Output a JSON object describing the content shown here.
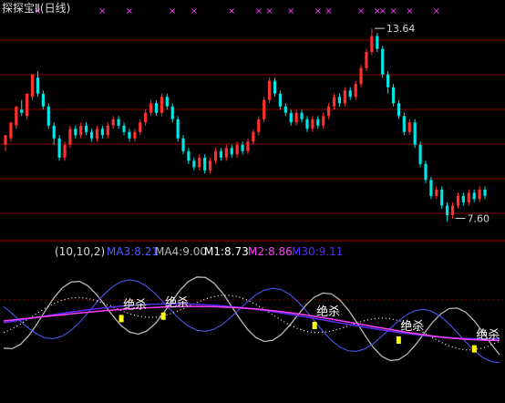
{
  "colors": {
    "background": "#000000",
    "grid": "#8b0000",
    "up_candle": "#ff3030",
    "down_candle": "#00e5e5",
    "marker": "#ff40ff",
    "signal": "#ffff00",
    "ma3": "#4f5cff",
    "ma4": "#b8b8b8",
    "m1": "#ffffff",
    "m2": "#ff40ff",
    "m30": "#5a2bff"
  },
  "chart_data": [
    {
      "type": "candlestick",
      "title": "探探宝Ⅱ(日线)",
      "annotations": [
        {
          "text": "13.64",
          "kind": "high"
        },
        {
          "text": "7.60",
          "kind": "low"
        }
      ],
      "candles": [
        [
          10.0,
          10.3,
          9.8,
          10.25
        ],
        [
          10.2,
          10.7,
          10.1,
          10.6
        ],
        [
          10.6,
          11.2,
          10.5,
          11.1
        ],
        [
          11.1,
          11.0,
          11.4,
          10.9
        ],
        [
          10.9,
          11.6,
          10.8,
          11.5
        ],
        [
          11.5,
          12.2,
          11.4,
          12.1
        ],
        [
          12.1,
          11.6,
          12.3,
          11.5
        ],
        [
          11.6,
          11.2,
          11.7,
          11.1
        ],
        [
          11.2,
          10.6,
          11.3,
          10.5
        ],
        [
          10.6,
          10.2,
          10.7,
          10.0
        ],
        [
          10.2,
          9.6,
          10.3,
          9.5
        ],
        [
          9.6,
          10.0,
          9.5,
          10.1
        ],
        [
          10.0,
          10.5,
          9.9,
          10.6
        ],
        [
          10.5,
          10.3,
          10.6,
          10.2
        ],
        [
          10.3,
          10.6,
          10.2,
          10.7
        ],
        [
          10.6,
          10.4,
          10.7,
          10.3
        ],
        [
          10.4,
          10.2,
          10.5,
          10.1
        ],
        [
          10.2,
          10.5,
          10.1,
          10.6
        ],
        [
          10.5,
          10.3,
          10.6,
          10.2
        ],
        [
          10.3,
          10.6,
          10.2,
          10.7
        ],
        [
          10.6,
          10.8,
          10.5,
          10.9
        ],
        [
          10.8,
          10.6,
          10.9,
          10.5
        ],
        [
          10.6,
          10.4,
          10.7,
          10.3
        ],
        [
          10.4,
          10.2,
          10.5,
          10.1
        ],
        [
          10.2,
          10.4,
          10.1,
          10.5
        ],
        [
          10.4,
          10.7,
          10.3,
          10.8
        ],
        [
          10.7,
          11.0,
          10.6,
          11.1
        ],
        [
          11.0,
          11.3,
          10.9,
          11.4
        ],
        [
          11.3,
          11.0,
          11.4,
          10.9
        ],
        [
          11.0,
          11.5,
          10.9,
          11.6
        ],
        [
          11.5,
          11.2,
          11.6,
          11.1
        ],
        [
          11.2,
          10.8,
          11.3,
          10.7
        ],
        [
          10.8,
          10.2,
          10.9,
          10.1
        ],
        [
          10.2,
          9.8,
          10.3,
          9.7
        ],
        [
          9.8,
          9.5,
          9.9,
          9.4
        ],
        [
          9.5,
          9.3,
          9.6,
          9.2
        ],
        [
          9.3,
          9.6,
          9.2,
          9.7
        ],
        [
          9.6,
          9.2,
          9.7,
          9.1
        ],
        [
          9.2,
          9.5,
          9.1,
          9.6
        ],
        [
          9.5,
          9.8,
          9.4,
          9.9
        ],
        [
          9.8,
          9.6,
          9.9,
          9.5
        ],
        [
          9.6,
          9.9,
          9.5,
          10.0
        ],
        [
          9.9,
          9.7,
          10.0,
          9.6
        ],
        [
          9.7,
          10.0,
          9.6,
          10.1
        ],
        [
          10.0,
          9.8,
          10.1,
          9.7
        ],
        [
          9.8,
          10.1,
          9.7,
          10.2
        ],
        [
          10.1,
          10.4,
          10.0,
          10.5
        ],
        [
          10.4,
          10.8,
          10.3,
          10.9
        ],
        [
          10.8,
          11.4,
          10.7,
          11.5
        ],
        [
          11.4,
          12.0,
          11.3,
          12.1
        ],
        [
          12.0,
          11.6,
          12.1,
          11.5
        ],
        [
          11.6,
          11.2,
          11.7,
          11.1
        ],
        [
          11.2,
          11.0,
          11.3,
          10.9
        ],
        [
          11.0,
          10.7,
          11.1,
          10.6
        ],
        [
          10.7,
          11.0,
          10.6,
          11.1
        ],
        [
          11.0,
          10.8,
          11.1,
          10.7
        ],
        [
          10.8,
          10.5,
          10.9,
          10.4
        ],
        [
          10.5,
          10.8,
          10.4,
          10.9
        ],
        [
          10.8,
          10.6,
          10.9,
          10.5
        ],
        [
          10.6,
          10.9,
          10.5,
          11.0
        ],
        [
          10.9,
          11.2,
          10.8,
          11.3
        ],
        [
          11.2,
          11.5,
          11.1,
          11.6
        ],
        [
          11.5,
          11.3,
          11.6,
          11.2
        ],
        [
          11.3,
          11.7,
          11.2,
          11.8
        ],
        [
          11.7,
          11.5,
          11.8,
          11.4
        ],
        [
          11.5,
          11.9,
          11.4,
          12.0
        ],
        [
          11.9,
          12.4,
          11.8,
          12.5
        ],
        [
          12.4,
          12.9,
          12.3,
          13.0
        ],
        [
          12.9,
          13.4,
          12.8,
          13.64
        ],
        [
          13.4,
          13.0,
          13.5,
          12.9
        ],
        [
          13.0,
          12.2,
          13.1,
          12.1
        ],
        [
          12.2,
          11.8,
          12.3,
          11.6
        ],
        [
          11.8,
          11.3,
          11.9,
          11.2
        ],
        [
          11.3,
          10.9,
          11.4,
          10.8
        ],
        [
          10.9,
          10.4,
          11.0,
          10.3
        ],
        [
          10.4,
          10.7,
          10.3,
          10.8
        ],
        [
          10.7,
          10.0,
          10.8,
          9.9
        ],
        [
          10.0,
          9.4,
          10.1,
          9.3
        ],
        [
          9.4,
          8.9,
          9.5,
          8.8
        ],
        [
          8.9,
          8.4,
          9.0,
          8.3
        ],
        [
          8.4,
          8.6,
          8.3,
          8.7
        ],
        [
          8.6,
          8.1,
          8.7,
          8.0
        ],
        [
          8.1,
          7.8,
          8.2,
          7.6
        ],
        [
          7.8,
          8.1,
          7.7,
          8.2
        ],
        [
          8.1,
          8.4,
          8.0,
          8.5
        ],
        [
          8.4,
          8.2,
          8.5,
          8.1
        ],
        [
          8.2,
          8.5,
          8.1,
          8.6
        ],
        [
          8.5,
          8.3,
          8.6,
          8.2
        ],
        [
          8.3,
          8.6,
          8.2,
          8.7
        ],
        [
          8.6,
          8.4,
          8.7,
          8.3
        ]
      ],
      "signals": [
        6,
        18,
        23,
        31,
        35,
        42,
        47,
        49,
        53,
        58,
        60,
        66,
        69,
        70,
        72,
        75,
        80
      ]
    },
    {
      "type": "line",
      "params": "(10,10,2)",
      "legend": [
        {
          "label": "MA3:8.21",
          "color": "#4f5cff"
        },
        {
          "label": "MA4:9.00",
          "color": "#b8b8b8"
        },
        {
          "label": "M1:8.73",
          "color": "#ffffff"
        },
        {
          "label": "M2:8.86",
          "color": "#ff40ff"
        },
        {
          "label": "M30:9.11",
          "color": "#5a2bff"
        }
      ],
      "annotation_text": "绝杀",
      "signal_points": [
        14,
        19,
        37,
        47,
        56,
        62
      ]
    }
  ]
}
